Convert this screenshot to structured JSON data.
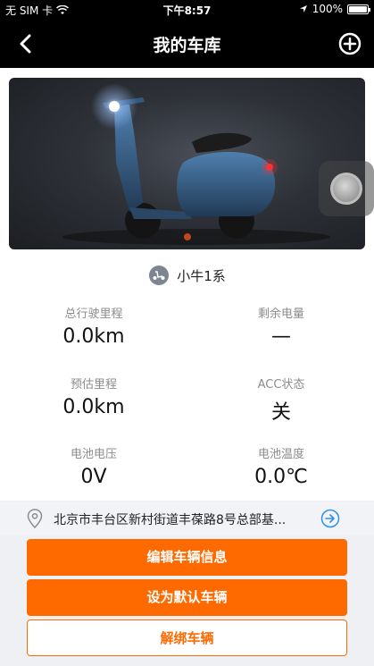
{
  "status_bar": {
    "carrier": "无 SIM 卡",
    "time": "下午8:57",
    "battery": "100%",
    "battery_level": 1.0
  },
  "nav": {
    "title": "我的车库",
    "back_icon": "chevron-left-icon",
    "add_icon": "plus-circle-icon"
  },
  "vehicle": {
    "model_icon": "scooter-icon",
    "model": "小牛1系"
  },
  "stats": {
    "total_mileage": {
      "label": "总行驶里程",
      "value": "0.0km"
    },
    "remaining_battery": {
      "label": "剩余电量",
      "value": "—"
    },
    "estimated_range": {
      "label": "预估里程",
      "value": "0.0km"
    },
    "acc_status": {
      "label": "ACC状态",
      "value": "关"
    },
    "battery_voltage": {
      "label": "电池电压",
      "value": "0V"
    },
    "battery_temp": {
      "label": "电池温度",
      "value": "0.0℃"
    }
  },
  "location": {
    "icon": "location-pin-icon",
    "address": "北京市丰台区新村街道丰葆路8号总部基...",
    "go_icon": "arrow-right-circle-icon"
  },
  "actions": {
    "edit": "编辑车辆信息",
    "set_default": "设为默认车辆",
    "unbind": "解绑车辆"
  },
  "colors": {
    "accent": "#ff6a00",
    "nav_bg": "#000000",
    "page_bg": "#eef0f4"
  }
}
